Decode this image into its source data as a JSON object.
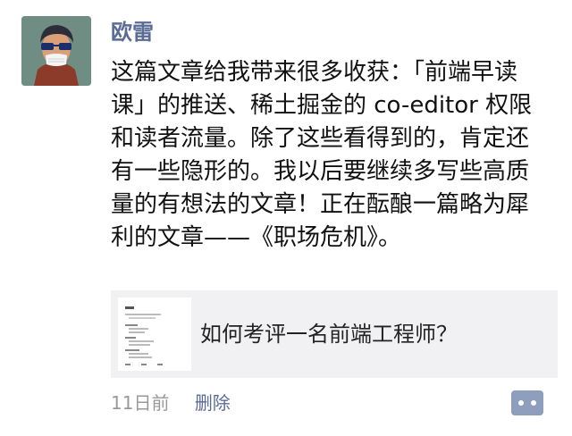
{
  "author": {
    "name": "欧雷",
    "avatar_icon": "user-avatar"
  },
  "post": {
    "text": "这篇文章给我带来很多收获：「前端早读课」的推送、稀土掘金的 co-editor 权限和读者流量。除了这些看得到的，肯定还有一些隐形的。我以后要继续多写些高质量的有想法的文章！正在酝酿一篇略为犀利的文章——《职场危机》。"
  },
  "link": {
    "title": "如何考评一名前端工程师？",
    "thumbnail_icon": "article-thumbnail"
  },
  "meta": {
    "time": "11日前",
    "delete_label": "删除",
    "comment_icon": "comment-icon"
  },
  "colors": {
    "name_link": "#5a6c96",
    "time_gray": "#999999",
    "card_bg": "#f1f1f3"
  }
}
